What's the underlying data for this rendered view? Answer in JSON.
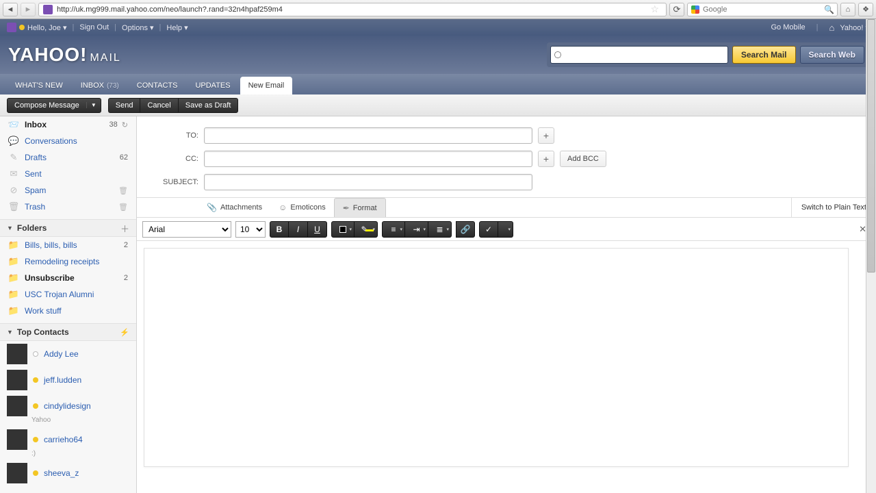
{
  "browser": {
    "url": "http://uk.mg999.mail.yahoo.com/neo/launch?.rand=32n4hpaf259m4",
    "search_placeholder": "Google"
  },
  "top_bar": {
    "greeting": "Hello, Joe",
    "sign_out": "Sign Out",
    "options": "Options",
    "help": "Help",
    "go_mobile": "Go Mobile",
    "yahoo_link": "Yahoo!"
  },
  "logo": {
    "main": "YAHOO!",
    "sub": "MAIL"
  },
  "search": {
    "mail_btn": "Search Mail",
    "web_btn": "Search Web"
  },
  "tabs": [
    {
      "label": "WHAT'S NEW"
    },
    {
      "label": "INBOX",
      "count": "(73)"
    },
    {
      "label": "CONTACTS"
    },
    {
      "label": "UPDATES"
    },
    {
      "label": "New Email",
      "active": true
    }
  ],
  "toolbar": {
    "compose": "Compose Message",
    "send": "Send",
    "cancel": "Cancel",
    "save_draft": "Save as Draft"
  },
  "system_folders": [
    {
      "name": "Inbox",
      "count": "38",
      "icon": "inbox",
      "bold": true,
      "refresh": true
    },
    {
      "name": "Conversations",
      "icon": "conv",
      "grey": true
    },
    {
      "name": "Drafts",
      "count": "62",
      "icon": "draft",
      "grey": true
    },
    {
      "name": "Sent",
      "icon": "sent",
      "grey": true
    },
    {
      "name": "Spam",
      "icon": "spam",
      "grey": true,
      "trash": true
    },
    {
      "name": "Trash",
      "icon": "trash",
      "grey": true,
      "trash": true
    }
  ],
  "folders_header": "Folders",
  "custom_folders": [
    {
      "name": "Bills, bills, bills",
      "count": "2"
    },
    {
      "name": "Remodeling receipts"
    },
    {
      "name": "Unsubscribe",
      "count": "2",
      "bold": true
    },
    {
      "name": "USC Trojan Alumni"
    },
    {
      "name": "Work stuff"
    }
  ],
  "contacts_header": "Top Contacts",
  "contacts": [
    {
      "name": "Addy Lee",
      "offline": true
    },
    {
      "name": "jeff.ludden"
    },
    {
      "name": "cindylidesign",
      "sub": "Yahoo"
    },
    {
      "name": "carrieho64",
      "sub": ":)"
    },
    {
      "name": "sheeva_z"
    }
  ],
  "compose": {
    "to_label": "TO:",
    "cc_label": "CC:",
    "subject_label": "SUBJECT:",
    "add_bcc": "Add BCC",
    "attachments": "Attachments",
    "emoticons": "Emoticons",
    "format": "Format",
    "switch_plain": "Switch to Plain Text",
    "font": "Arial",
    "size": "10"
  }
}
